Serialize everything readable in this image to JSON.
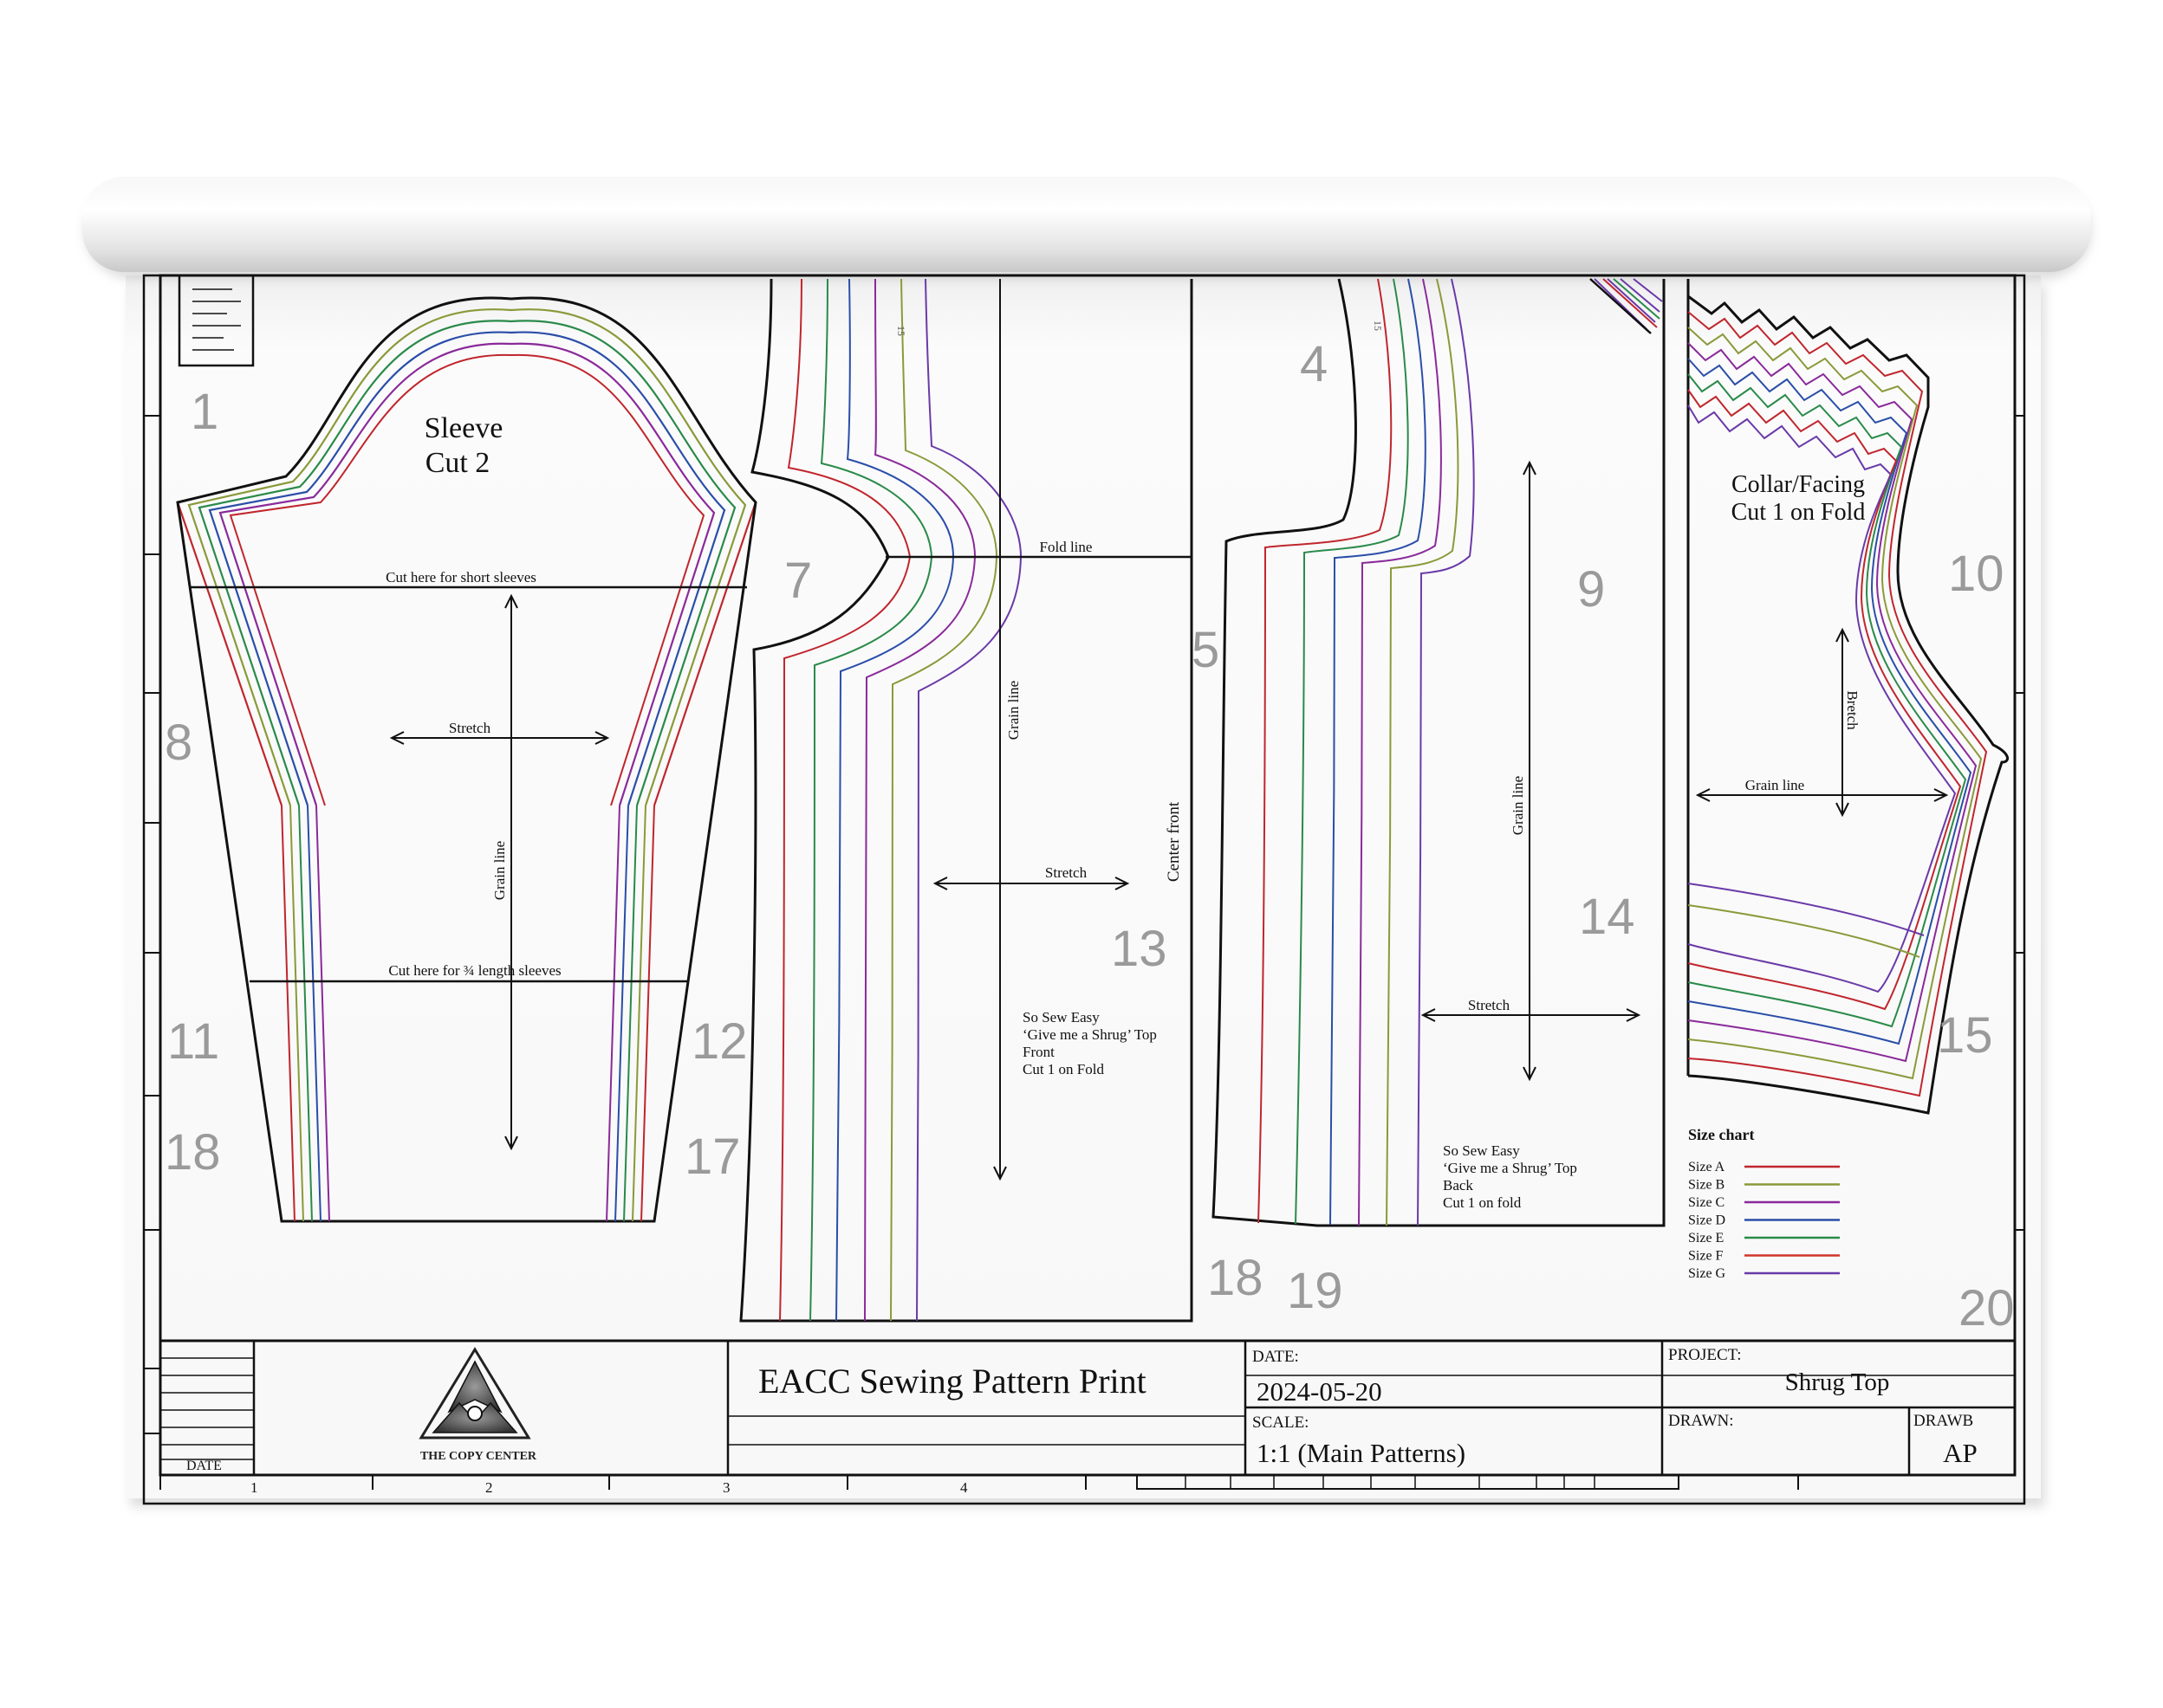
{
  "title_block": {
    "company_name": "THE COPY CENTER",
    "date_cell_label": "DATE",
    "title": "EACC Sewing Pattern Print",
    "date_label": "DATE:",
    "date_value": "2024-05-20",
    "scale_label": "SCALE:",
    "scale_value": "1:1 (Main Patterns)",
    "project_label": "PROJECT:",
    "project_value": "Shrug Top",
    "drawn_label": "DRAWN:",
    "drawn_value": "",
    "drawb_label": "DRAWB",
    "drawb_value": "AP"
  },
  "ruler_numbers": [
    "1",
    "2",
    "3",
    "4"
  ],
  "sleeve": {
    "title_line1": "Sleeve",
    "title_line2": "Cut 2",
    "cut_short": "Cut here for short sleeves",
    "cut_three_quarter": "Cut here for ¾ length sleeves",
    "stretch": "Stretch",
    "grain": "Grain line"
  },
  "front": {
    "fold_line": "Fold line",
    "grain": "Grain line",
    "stretch": "Stretch",
    "center_front": "Center front",
    "label_line1": "So Sew Easy",
    "label_line2": "‘Give me a Shrug’ Top",
    "label_line3": "Front",
    "label_line4": "Cut 1 on Fold"
  },
  "back": {
    "grain": "Grain line",
    "stretch": "Stretch",
    "label_line1": "So Sew Easy",
    "label_line2": "‘Give me a Shrug’ Top",
    "label_line3": "Back",
    "label_line4": "Cut 1 on fold"
  },
  "collar": {
    "title_line1": "Collar/Facing",
    "title_line2": "Cut 1 on Fold",
    "stretch": "Bretch",
    "grain": "Grain line"
  },
  "small_marks": [
    "15",
    "15"
  ],
  "page_numbers": [
    "1",
    "4",
    "7",
    "5",
    "9",
    "10",
    "8",
    "13",
    "14",
    "11",
    "12",
    "15",
    "18",
    "17",
    "18",
    "19",
    "20"
  ],
  "size_chart": {
    "title": "Size chart",
    "sizes": [
      {
        "label": "Size A",
        "color": "#c0262d"
      },
      {
        "label": "Size B",
        "color": "#8a9a3a"
      },
      {
        "label": "Size C",
        "color": "#8a2a9a"
      },
      {
        "label": "Size D",
        "color": "#2a4ea8"
      },
      {
        "label": "Size E",
        "color": "#2a8a4a"
      },
      {
        "label": "Size F",
        "color": "#d0342a"
      },
      {
        "label": "Size G",
        "color": "#6a3aa8"
      }
    ]
  }
}
